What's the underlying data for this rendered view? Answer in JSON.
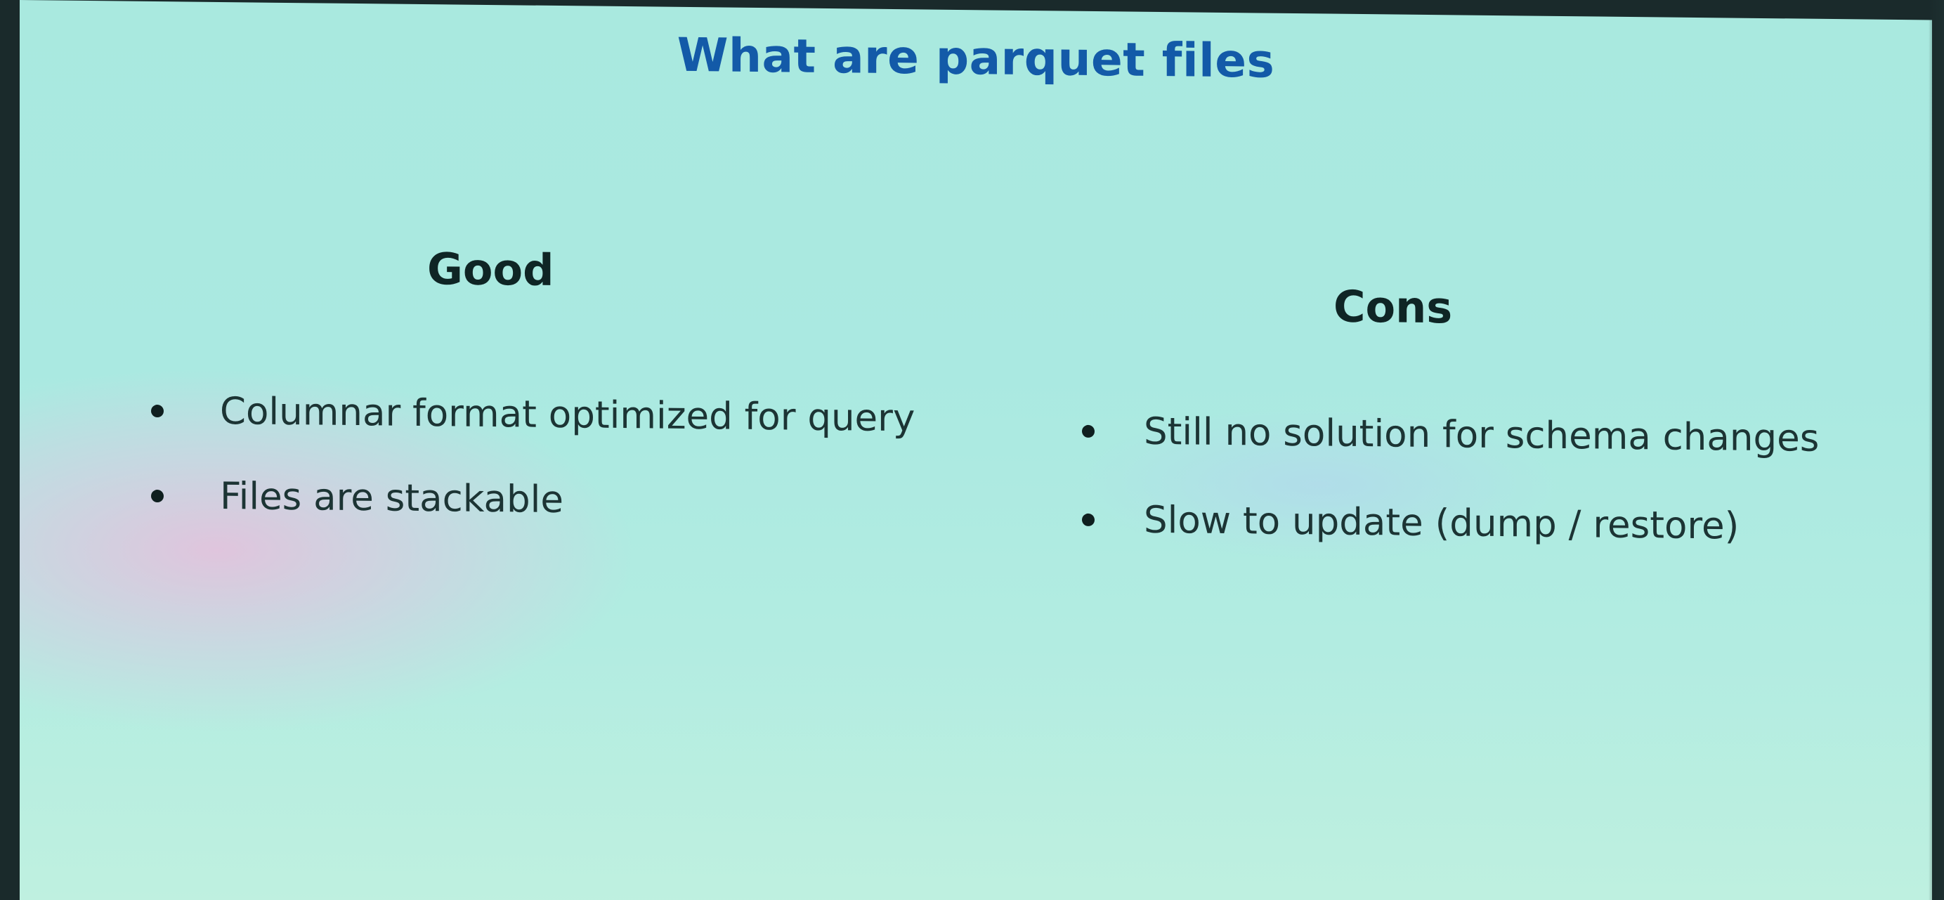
{
  "slide": {
    "title": "What are parquet files",
    "good": {
      "heading": "Good",
      "items": [
        "Columnar format optimized for query",
        "Files are stackable"
      ]
    },
    "cons": {
      "heading": "Cons",
      "items": [
        "Still no solution for schema changes",
        "Slow to update (dump / restore)"
      ]
    }
  },
  "colors": {
    "background": "#aae9e1",
    "title": "#135aa8",
    "text": "#1c3434"
  }
}
